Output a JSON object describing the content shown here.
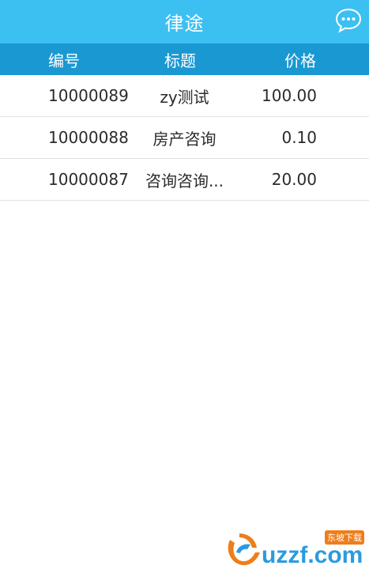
{
  "app": {
    "title": "律途"
  },
  "table": {
    "headers": {
      "id": "编号",
      "title": "标题",
      "price": "价格"
    },
    "rows": [
      {
        "id": "10000089",
        "title": "zy测试",
        "price": "100.00"
      },
      {
        "id": "10000088",
        "title": "房产咨询",
        "price": "0.10"
      },
      {
        "id": "10000087",
        "title": "咨询咨询...",
        "price": "20.00"
      }
    ]
  },
  "watermark": {
    "brand": "uzzf.com",
    "tag": "东坡下载"
  },
  "colors": {
    "titlebar": "#3cc0f2",
    "header": "#1a98d2",
    "text": "#2b2b2b"
  },
  "icons": {
    "chat": "chat-bubble-icon"
  }
}
